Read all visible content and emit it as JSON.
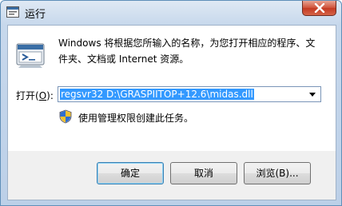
{
  "window": {
    "title": "运行",
    "close_icon": "close-icon"
  },
  "dialog": {
    "icon": "run-icon",
    "description": "Windows 将根据您所输入的名称，为您打开相应的程序、文件夹、文档或 Internet 资源。",
    "open_label_prefix": "打开(",
    "open_label_accel": "O",
    "open_label_suffix": "):",
    "command_value": "regsvr32  D:\\GRASPIITOP+12.6\\midas.dll",
    "admin_note": "使用管理权限创建此任务。",
    "shield_icon": "uac-shield-icon"
  },
  "buttons": {
    "ok": "确定",
    "cancel": "取消",
    "browse": "浏览(B)..."
  },
  "colors": {
    "selection": "#3399ff",
    "close_button": "#c9452b",
    "titlebar": "#c7d8ec"
  }
}
